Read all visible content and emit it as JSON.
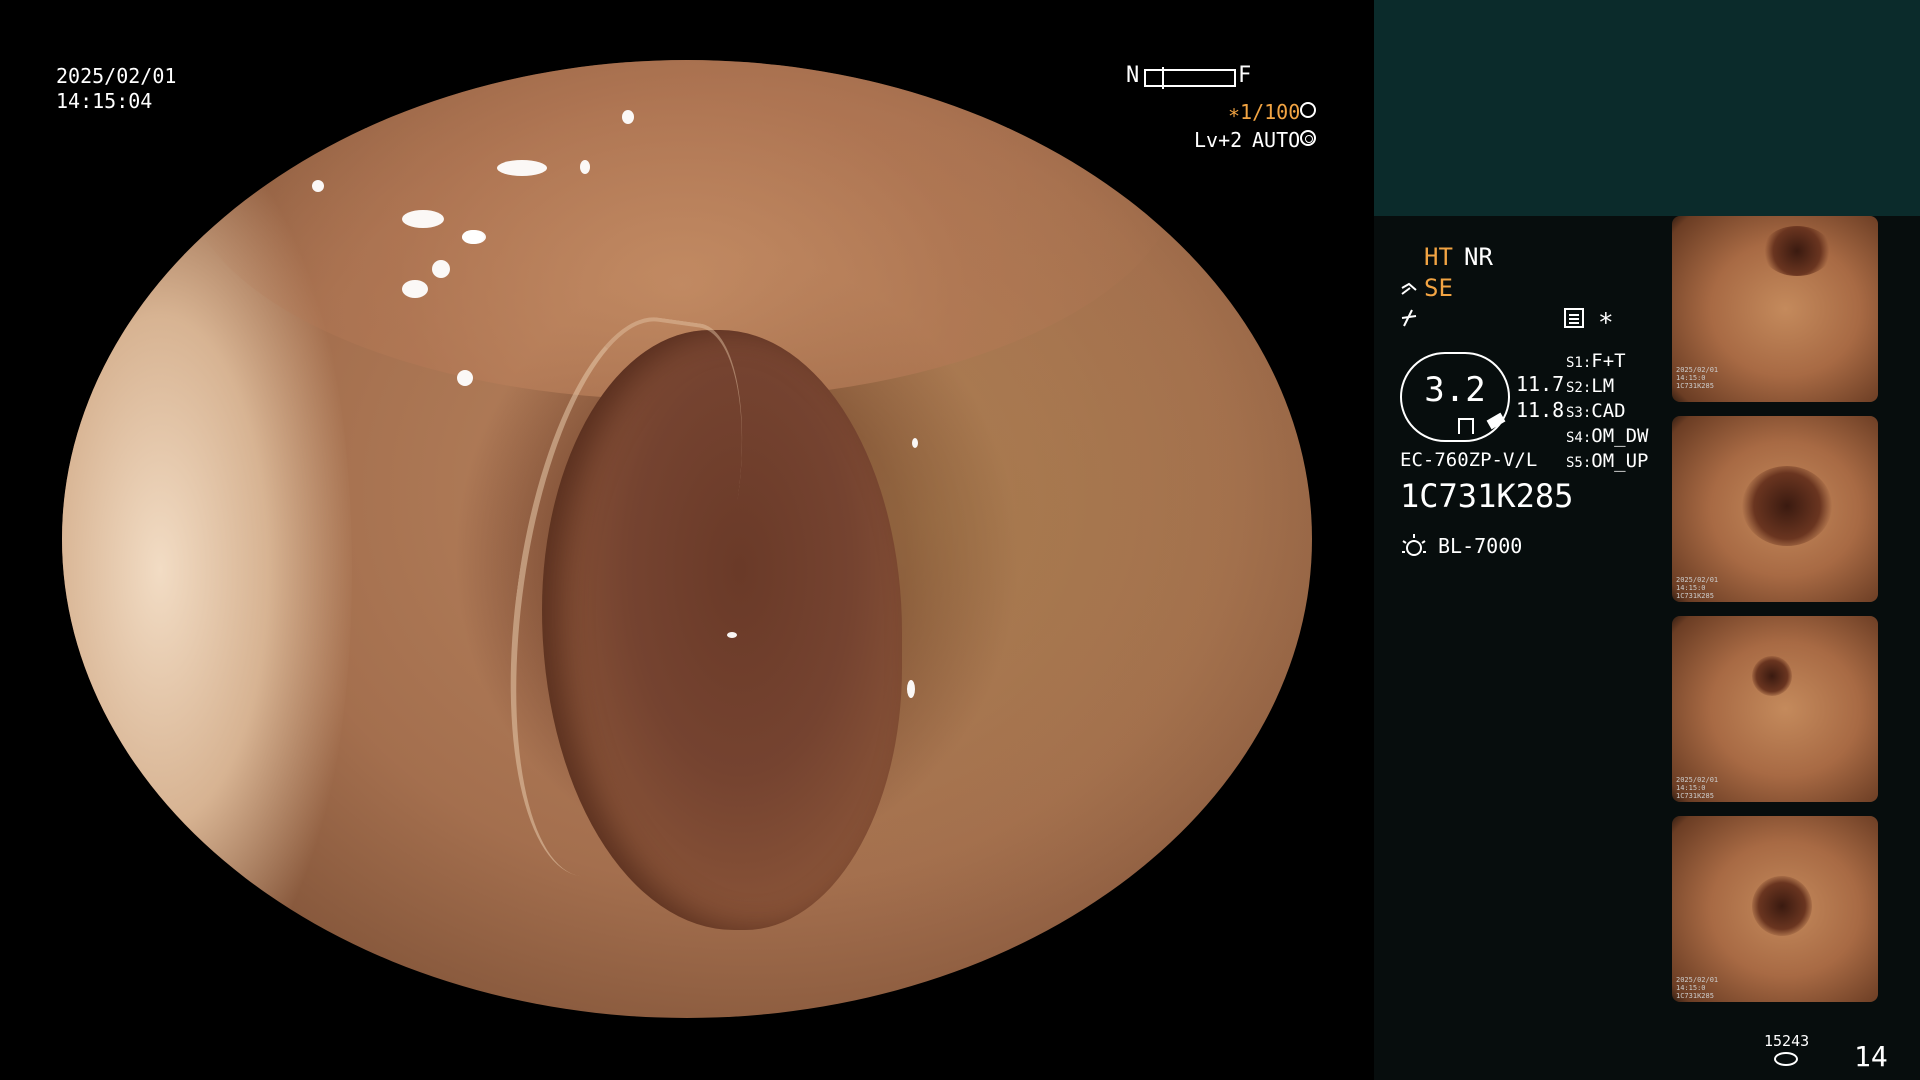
{
  "overlay": {
    "date": "2025/02/01",
    "time": "14:15:04",
    "focus_near": "N",
    "focus_far": "F",
    "shutter": "∗1/100",
    "shutter_icon": "aperture-icon",
    "iris_level": "Lv+2",
    "iris_mode": "AUTO",
    "iris_icon": "iris-icon"
  },
  "panel": {
    "ht": "HT",
    "nr": "NR",
    "se": "SE",
    "menu_asterisk": "∗",
    "zoom_value": "3.2",
    "value_top": "11.7",
    "value_bottom": "11.8",
    "scope_model": "EC-760ZP-V/L",
    "serial": "1C731K285",
    "light_source": "BL-7000",
    "switches": [
      {
        "key": "S1",
        "label": "F+T"
      },
      {
        "key": "S2",
        "label": "LM"
      },
      {
        "key": "S3",
        "label": "CAD"
      },
      {
        "key": "S4",
        "label": "OM_DW"
      },
      {
        "key": "S5",
        "label": "OM_UP"
      }
    ],
    "storage_count": "15243",
    "image_count": "14"
  },
  "thumbnails": [
    {
      "caption": "2025/02/01\n14:15:0\n1C731K285"
    },
    {
      "caption": "2025/02/01\n14:15:0\n1C731K285"
    },
    {
      "caption": "2025/02/01\n14:15:0\n1C731K285"
    },
    {
      "caption": "2025/02/01\n14:15:0\n1C731K285"
    }
  ],
  "colors": {
    "accent_orange": "#f2a443",
    "panel_top": "#0b2b2b",
    "panel_bg": "#070d0d"
  }
}
